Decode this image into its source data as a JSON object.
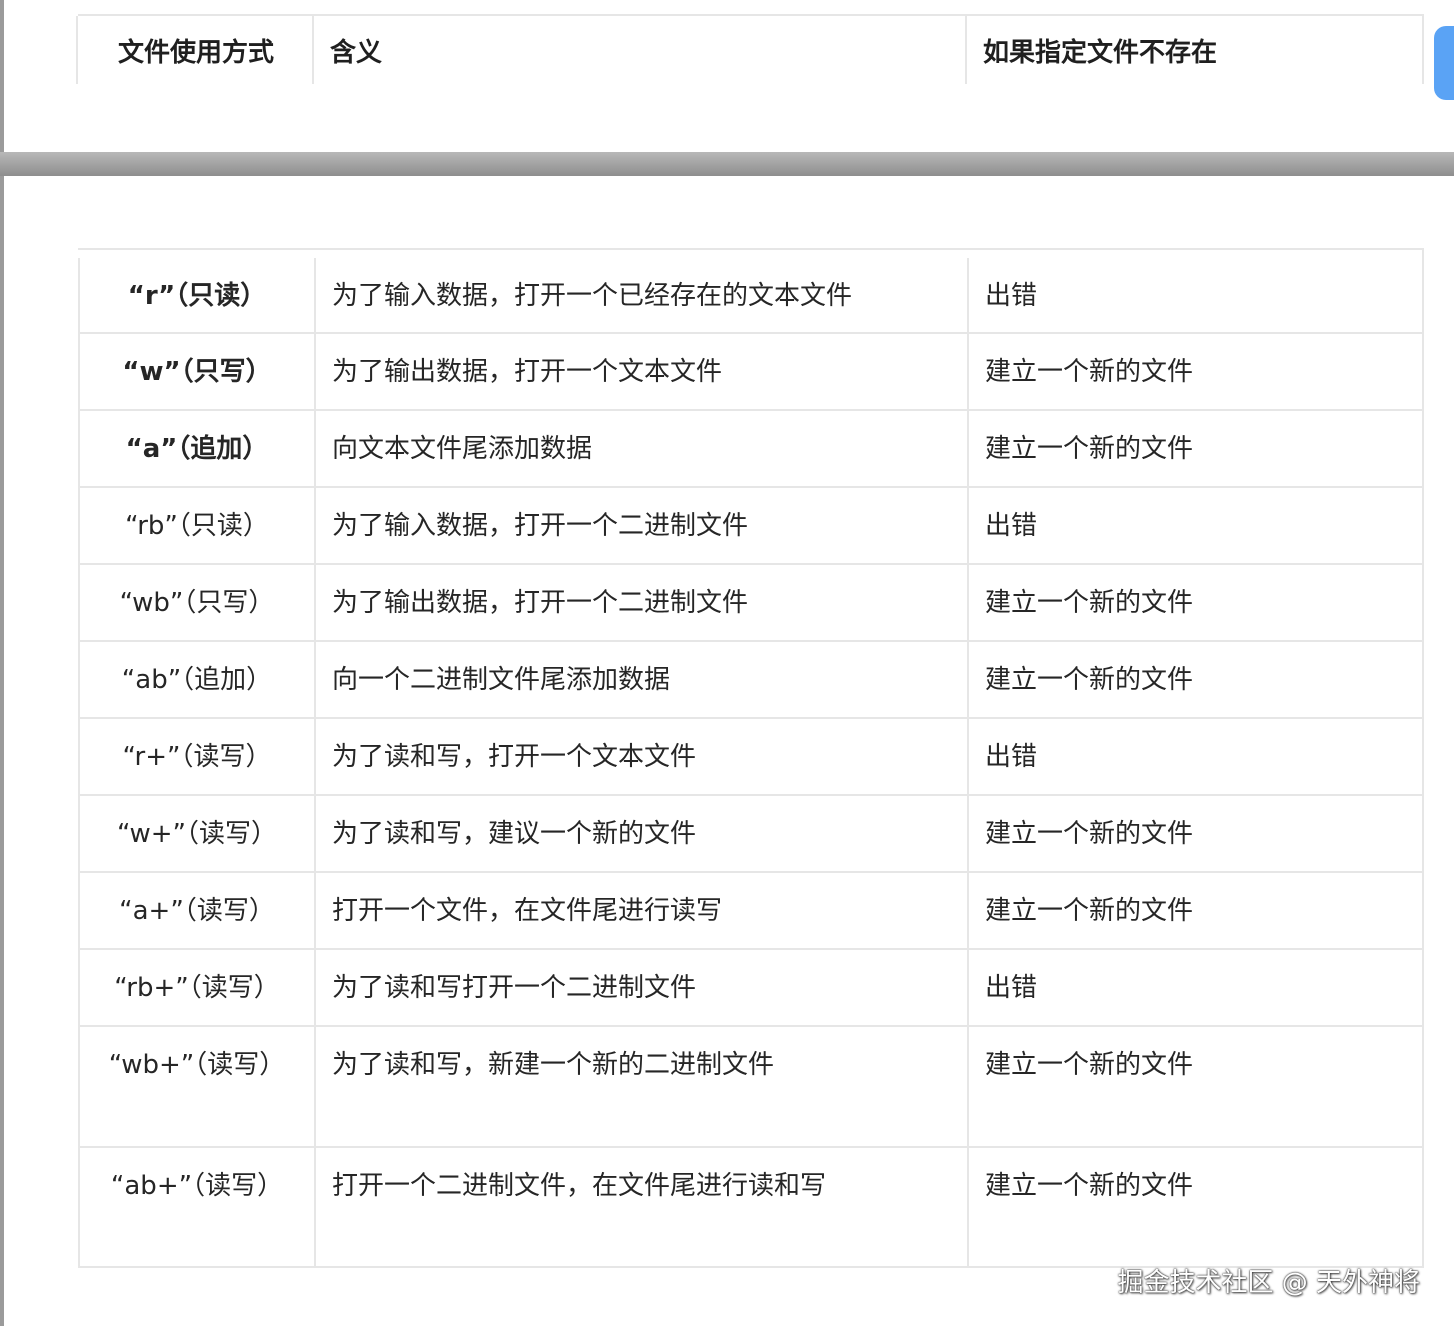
{
  "header": {
    "col1": "文件使用方式",
    "col2": "含义",
    "col3": "如果指定文件不存在"
  },
  "rows": [
    {
      "mode": "“r”（只读）",
      "meaning": "为了输入数据，打开一个已经存在的文本文件",
      "if_missing": "出错",
      "bold": true
    },
    {
      "mode": "“w”（只写）",
      "meaning": "为了输出数据，打开一个文本文件",
      "if_missing": "建立一个新的文件",
      "bold": true
    },
    {
      "mode": "“a”（追加）",
      "meaning": "向文本文件尾添加数据",
      "if_missing": "建立一个新的文件",
      "bold": true
    },
    {
      "mode": "“rb”（只读）",
      "meaning": "为了输入数据，打开一个二进制文件",
      "if_missing": "出错",
      "bold": false
    },
    {
      "mode": "“wb”（只写）",
      "meaning": "为了输出数据，打开一个二进制文件",
      "if_missing": "建立一个新的文件",
      "bold": false
    },
    {
      "mode": "“ab”（追加）",
      "meaning": "向一个二进制文件尾添加数据",
      "if_missing": "建立一个新的文件",
      "bold": false
    },
    {
      "mode": "“r+”（读写）",
      "meaning": "为了读和写，打开一个文本文件",
      "if_missing": "出错",
      "bold": false
    },
    {
      "mode": "“w+”（读写）",
      "meaning": "为了读和写，建议一个新的文件",
      "if_missing": "建立一个新的文件",
      "bold": false
    },
    {
      "mode": "“a+”（读写）",
      "meaning": "打开一个文件，在文件尾进行读写",
      "if_missing": "建立一个新的文件",
      "bold": false
    },
    {
      "mode": "“rb+”（读写）",
      "meaning": "为了读和写打开一个二进制文件",
      "if_missing": "出错",
      "bold": false
    },
    {
      "mode": "“wb+”（读写）",
      "meaning": "为了读和写，新建一个新的二进制文件",
      "if_missing": "建立一个新的文件",
      "bold": false
    },
    {
      "mode": "“ab+”（读写）",
      "meaning": "打开一个二进制文件，在文件尾进行读和写",
      "if_missing": "建立一个新的文件",
      "bold": false
    }
  ],
  "watermark": "掘金技术社区 @ 天外神将"
}
